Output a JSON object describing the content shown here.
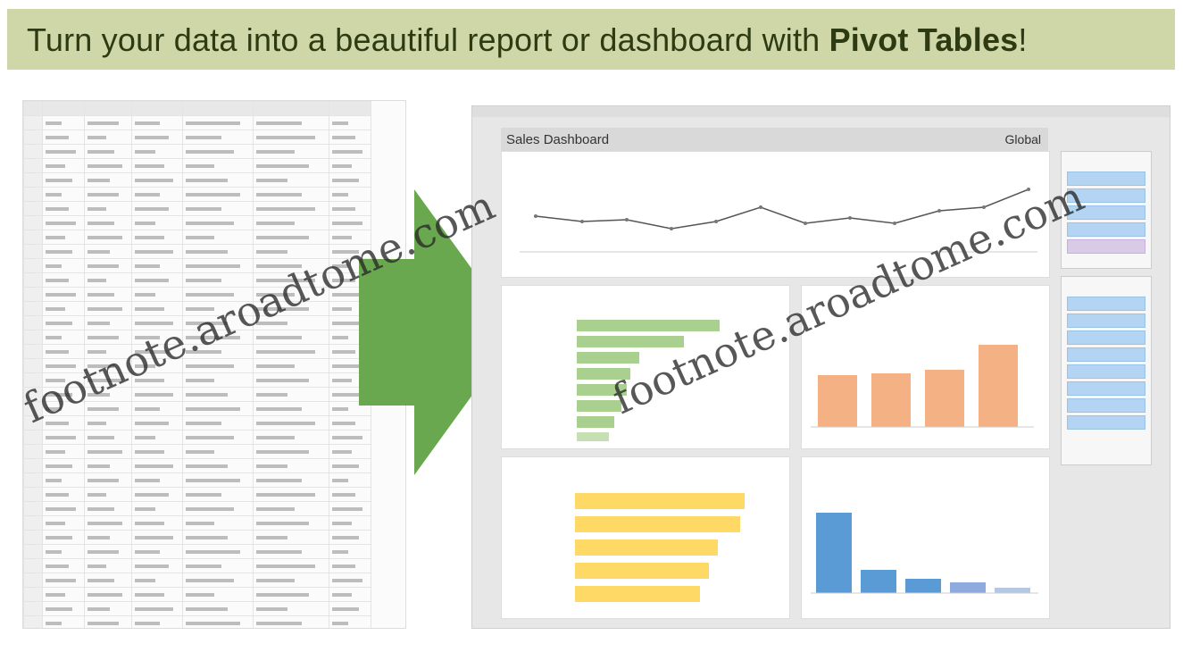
{
  "banner": {
    "text_prefix": "Turn your data into a beautiful report or dashboard with ",
    "text_bold": "Pivot Tables",
    "text_suffix": "!",
    "background": "#cfd6a8"
  },
  "dashboard": {
    "title": "Sales Dashboard",
    "subtitle": "Global"
  },
  "watermark": {
    "text": "footnote.aroadtome.com"
  },
  "arrow": {
    "color": "#6aa84f"
  }
}
